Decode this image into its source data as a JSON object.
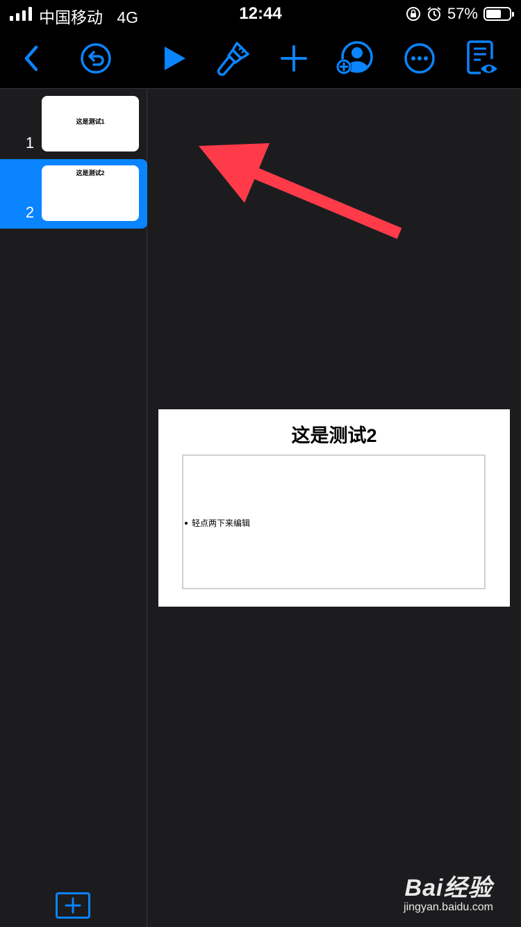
{
  "status_bar": {
    "carrier": "中国移动",
    "network": "4G",
    "time": "12:44",
    "battery_percent": "57%"
  },
  "toolbar": {
    "icons": [
      "back-icon",
      "undo-icon",
      "play-icon",
      "paintbrush-icon",
      "add-icon",
      "collaborate-icon",
      "more-icon",
      "presenter-notes-icon"
    ],
    "accent": "#0a84ff"
  },
  "sidebar": {
    "slides": [
      {
        "number": "1",
        "title": "这是测试1",
        "selected": false
      },
      {
        "number": "2",
        "title": "这是测试2",
        "selected": true
      }
    ],
    "add_icon": "add-slide-icon"
  },
  "slide": {
    "title": "这是测试2",
    "body_placeholder": "轻点两下来编辑"
  },
  "annotation": {
    "arrow_color": "#ff3b4a"
  },
  "watermark": {
    "brand": "Bai经验",
    "url": "jingyan.baidu.com"
  }
}
